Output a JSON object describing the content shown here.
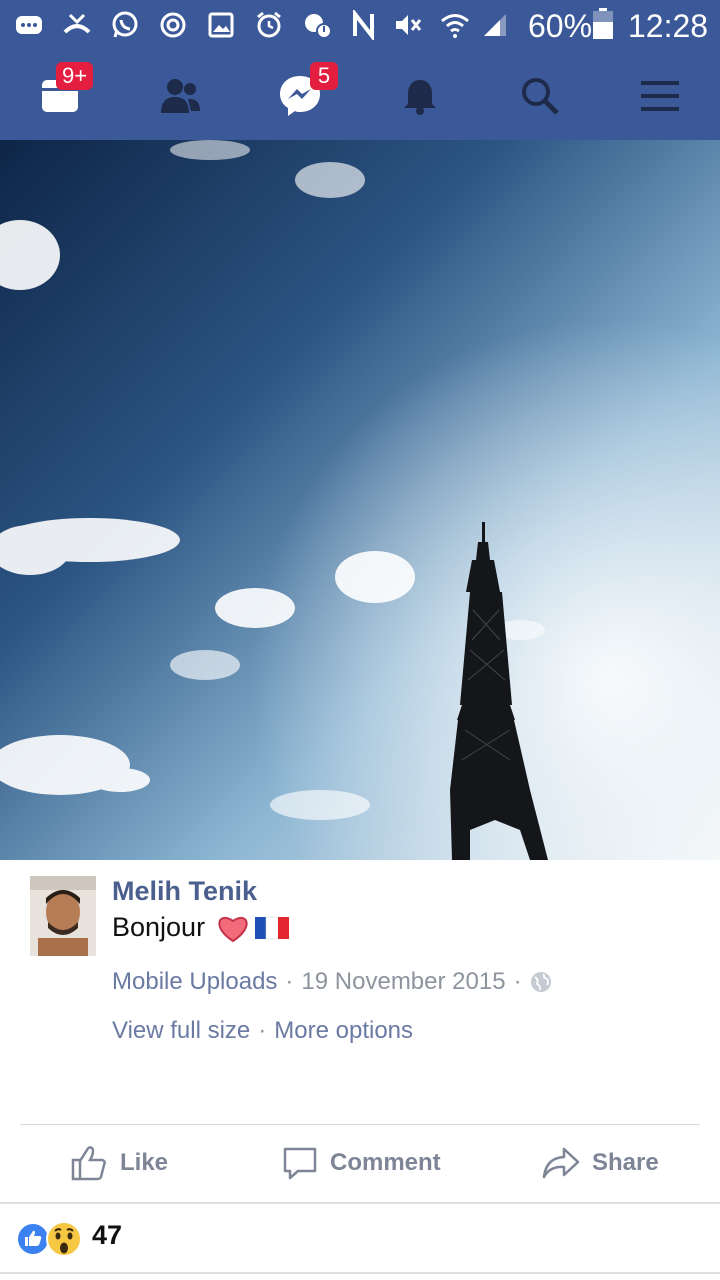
{
  "status_bar": {
    "battery": "60%",
    "time": "12:28"
  },
  "navbar": {
    "notifications_badge": "9+",
    "messages_badge": "5"
  },
  "post": {
    "author": "Melih Tenik",
    "caption": "Bonjour",
    "caption_emoji": "heart-and-france-flag",
    "album": "Mobile Uploads",
    "date": "19 November 2015",
    "privacy_icon": "globe-icon",
    "separator": "·",
    "view_full_size": "View full size",
    "more_options": "More options"
  },
  "actions": {
    "like": "Like",
    "comment": "Comment",
    "share": "Share"
  },
  "reactions": {
    "count": "47",
    "types": [
      "like",
      "wow"
    ]
  },
  "colors": {
    "brand": "#3b5998",
    "badge": "#e41e3f",
    "link": "#6a7aa2",
    "action": "#7d8596"
  }
}
